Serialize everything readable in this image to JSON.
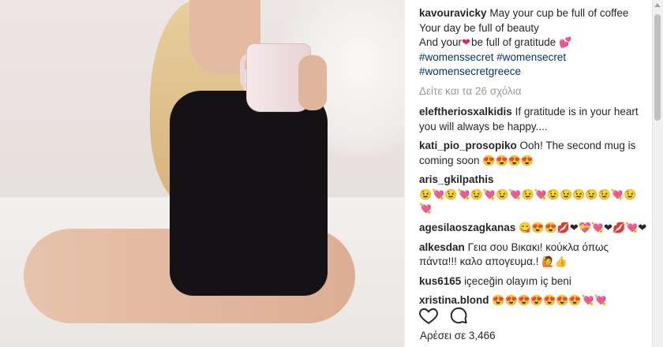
{
  "post": {
    "photo_alt": "",
    "caption": {
      "username": "kavouravicky",
      "line1": "May your cup be full of coffee",
      "line2": "Your day be full of beauty",
      "line3a": "And your",
      "line3_emoji": "❤",
      "line3b": "be full of gratitude",
      "line3_emoji2": "💕",
      "hashtags1": "#womenssecret #womensecret",
      "hashtags2": "#womensecretgreece"
    },
    "view_all": "Δείτε και τα 26 σχόλια",
    "comments": [
      {
        "user": "eleftheriosxalkidis",
        "text": "If gratitude is in your heart you will always be happy...."
      },
      {
        "user": "kati_pio_prosopiko",
        "text": "Ooh! The second mug is coming soon",
        "emojis": "😍😍😍😍"
      },
      {
        "user": "aris_gkilpathis",
        "text": "",
        "emojis": "😉💘😉💘😉💘😉💘😉💘😉😉😉😉😉💘😉💘"
      },
      {
        "user": "agesilaoszagkanas",
        "text": "",
        "emojis": "😋😍😍💋❤💝💘❤💋💘❤"
      },
      {
        "user": "alkesdan",
        "text": "Γεια σου Βικακι! κούκλα όπως πάντα!!! καλο απογευμα.!",
        "emojis": "🙋👍"
      },
      {
        "user": "kus6165",
        "text": "içeceğin olayım iç beni"
      },
      {
        "user": "xristina.blond",
        "text": "",
        "emojis": "😍😍😍😍😍😍😍💘💘"
      }
    ],
    "likes": "Αρέσει σε 3,466",
    "icons": {
      "like": "heart-icon",
      "comment": "comment-icon"
    }
  }
}
